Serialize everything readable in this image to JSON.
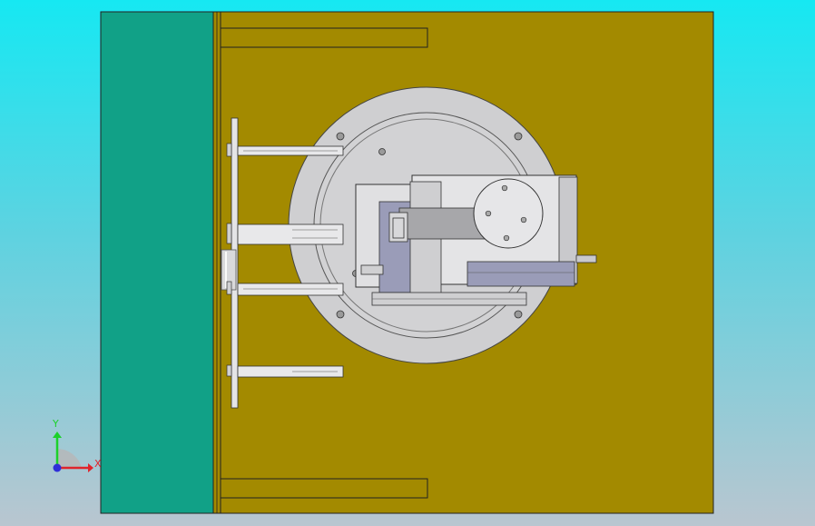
{
  "viewport": {
    "background_top": "#16e8f2",
    "background_bottom": "#b9c6d0"
  },
  "model": {
    "base_plate_color": "#a38a00",
    "side_panel_color": "#11a187",
    "disc_color": "#cfcfd1",
    "steel_color": "#e4e4e6",
    "motor_color": "#9a9cb8",
    "edge_color": "#222222"
  },
  "triad": {
    "x_label": "X",
    "y_label": "Y",
    "x_color": "#e0242b",
    "y_color": "#1bd12a",
    "z_color": "#2f2fd8"
  }
}
